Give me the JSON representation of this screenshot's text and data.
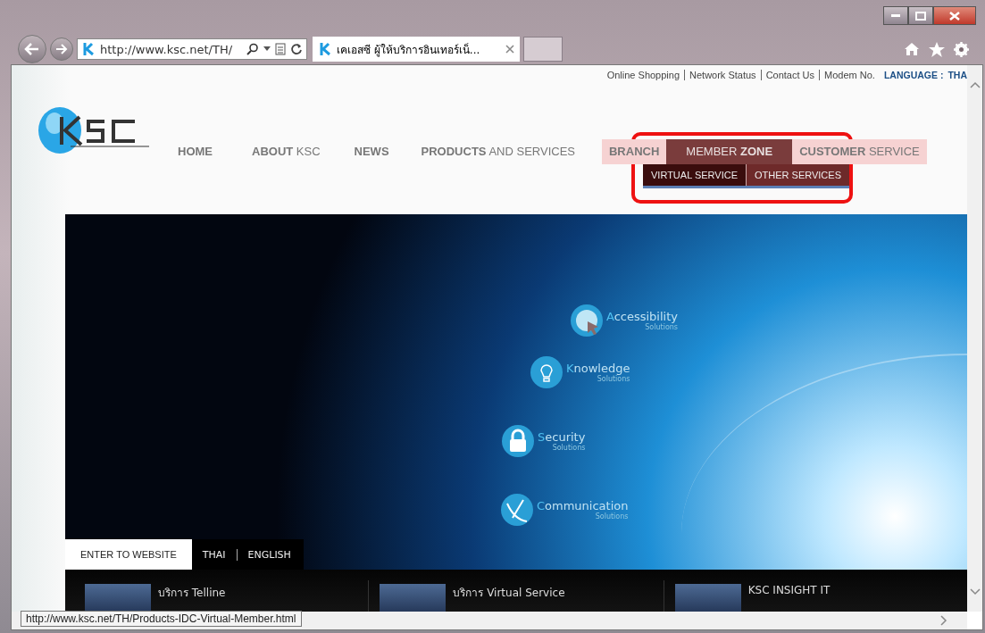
{
  "browser": {
    "address": "http://www.ksc.net/TH/",
    "tab_title": "เคเอสซี ผู้ให้บริการอินเทอร์เน็...",
    "status_url": "http://www.ksc.net/TH/Products-IDC-Virtual-Member.html"
  },
  "top_links": [
    "Online Shopping",
    "Network Status",
    "Contact Us",
    "Modem No."
  ],
  "language": {
    "label": "LANGUAGE :",
    "value": "THA"
  },
  "nav": [
    {
      "label": "**HOME**",
      "selected": false
    },
    {
      "label": "**ABOUT** KSC",
      "selected": false
    },
    {
      "label": "**NEWS**",
      "selected": false
    },
    {
      "label": "**PRODUCTS** AND SERVICES",
      "selected": false
    },
    {
      "label": "**BRANCH**",
      "selected": false
    },
    {
      "label": "MEMBER **ZONE**",
      "selected": true
    },
    {
      "label": "**CUSTOMER** SERVICE",
      "selected": false
    }
  ],
  "submenu": [
    {
      "label": "VIRTUAL SERVICE",
      "selected": true
    },
    {
      "label": "OTHER SERVICES",
      "selected": false
    }
  ],
  "solutions": [
    {
      "kind": "cursor",
      "title": "Accessibility",
      "subtitle": "Solutions"
    },
    {
      "kind": "bulb",
      "title": "Knowledge",
      "subtitle": "Solutions"
    },
    {
      "kind": "lock",
      "title": "Security",
      "subtitle": "Solutions"
    },
    {
      "kind": "satellite",
      "title": "Communication",
      "subtitle": "Solutions"
    }
  ],
  "enter": {
    "button": "ENTER TO WEBSITE",
    "languages": [
      "THAI",
      "ENGLISH"
    ]
  },
  "news": [
    {
      "title": "บริการ Telline"
    },
    {
      "title": "บริการ Virtual Service"
    },
    {
      "title": "KSC INSIGHT IT"
    }
  ]
}
